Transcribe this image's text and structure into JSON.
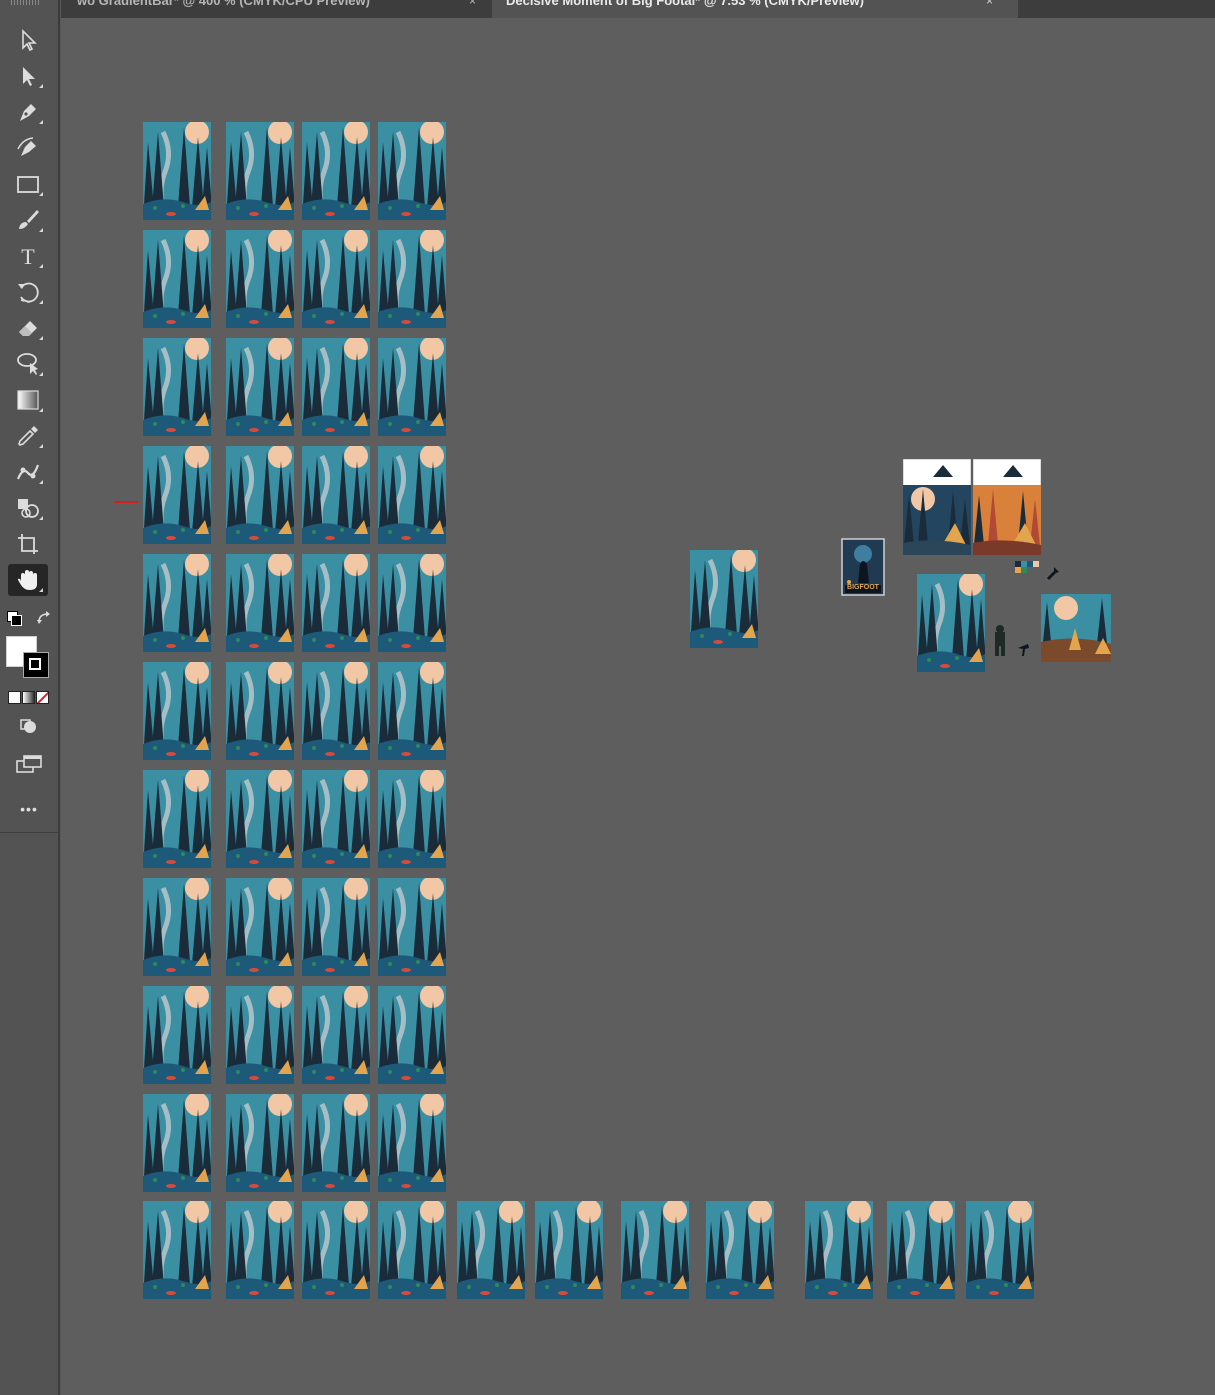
{
  "tabs": [
    {
      "title": "wo GradientBar* @ 400 % (CMYK/CPU Preview)",
      "close_glyph": "×"
    },
    {
      "title": "Decisive Moment of Big Footal* @ 7.53 % (CMYK/Preview)",
      "close_glyph": "×",
      "active": true
    }
  ],
  "toolbar": {
    "tools": [
      {
        "name": "selection-tool",
        "icon": "arrow-icon"
      },
      {
        "name": "direct-selection-tool",
        "icon": "white-arrow-icon"
      },
      {
        "name": "pen-tool",
        "icon": "pen-icon"
      },
      {
        "name": "curvature-tool",
        "icon": "curvature-pen-icon"
      },
      {
        "name": "rectangle-tool",
        "icon": "rectangle-icon"
      },
      {
        "name": "paintbrush-tool",
        "icon": "brush-icon"
      },
      {
        "name": "type-tool",
        "icon": "type-icon",
        "label": "T"
      },
      {
        "name": "rotate-tool",
        "icon": "rotate-icon"
      },
      {
        "name": "eraser-tool",
        "icon": "eraser-icon"
      },
      {
        "name": "lasso-tool",
        "icon": "lasso-icon"
      },
      {
        "name": "gradient-tool",
        "icon": "gradient-icon"
      },
      {
        "name": "eyedropper-tool",
        "icon": "eyedropper-icon"
      },
      {
        "name": "puppet-warp-tool",
        "icon": "puppet-warp-icon"
      },
      {
        "name": "shape-builder-tool",
        "icon": "shape-builder-icon"
      },
      {
        "name": "artboard-tool",
        "icon": "artboard-icon"
      },
      {
        "name": "hand-tool",
        "icon": "hand-icon",
        "active": true
      }
    ],
    "more_label": "•••"
  },
  "canvas": {
    "poster_label": "BIGFOOT",
    "colors": {
      "sky": "#3a8fa3",
      "trees": "#1a2b3a",
      "moon": "#f2c7a5",
      "ground": "#1d5a7a",
      "tent": "#e2a44c",
      "ember": "#d94a3a",
      "canvas_bg": "#5e5e5e",
      "toolbar_bg": "#535353"
    }
  }
}
